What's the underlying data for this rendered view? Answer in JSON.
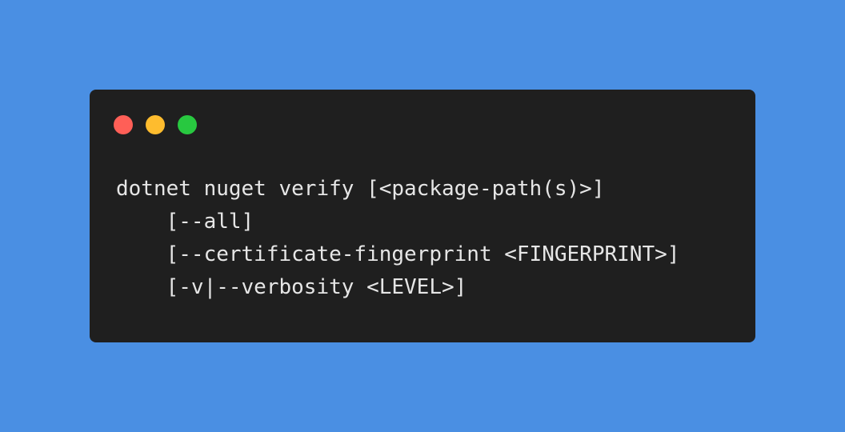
{
  "window": {
    "controls": [
      {
        "name": "close",
        "color": "#ff5f57"
      },
      {
        "name": "minimize",
        "color": "#febc2e"
      },
      {
        "name": "zoom",
        "color": "#28c840"
      }
    ]
  },
  "code": {
    "lines": [
      "dotnet nuget verify [<package-path(s)>]",
      "    [--all]",
      "    [--certificate-fingerprint <FINGERPRINT>]",
      "    [-v|--verbosity <LEVEL>]"
    ]
  }
}
